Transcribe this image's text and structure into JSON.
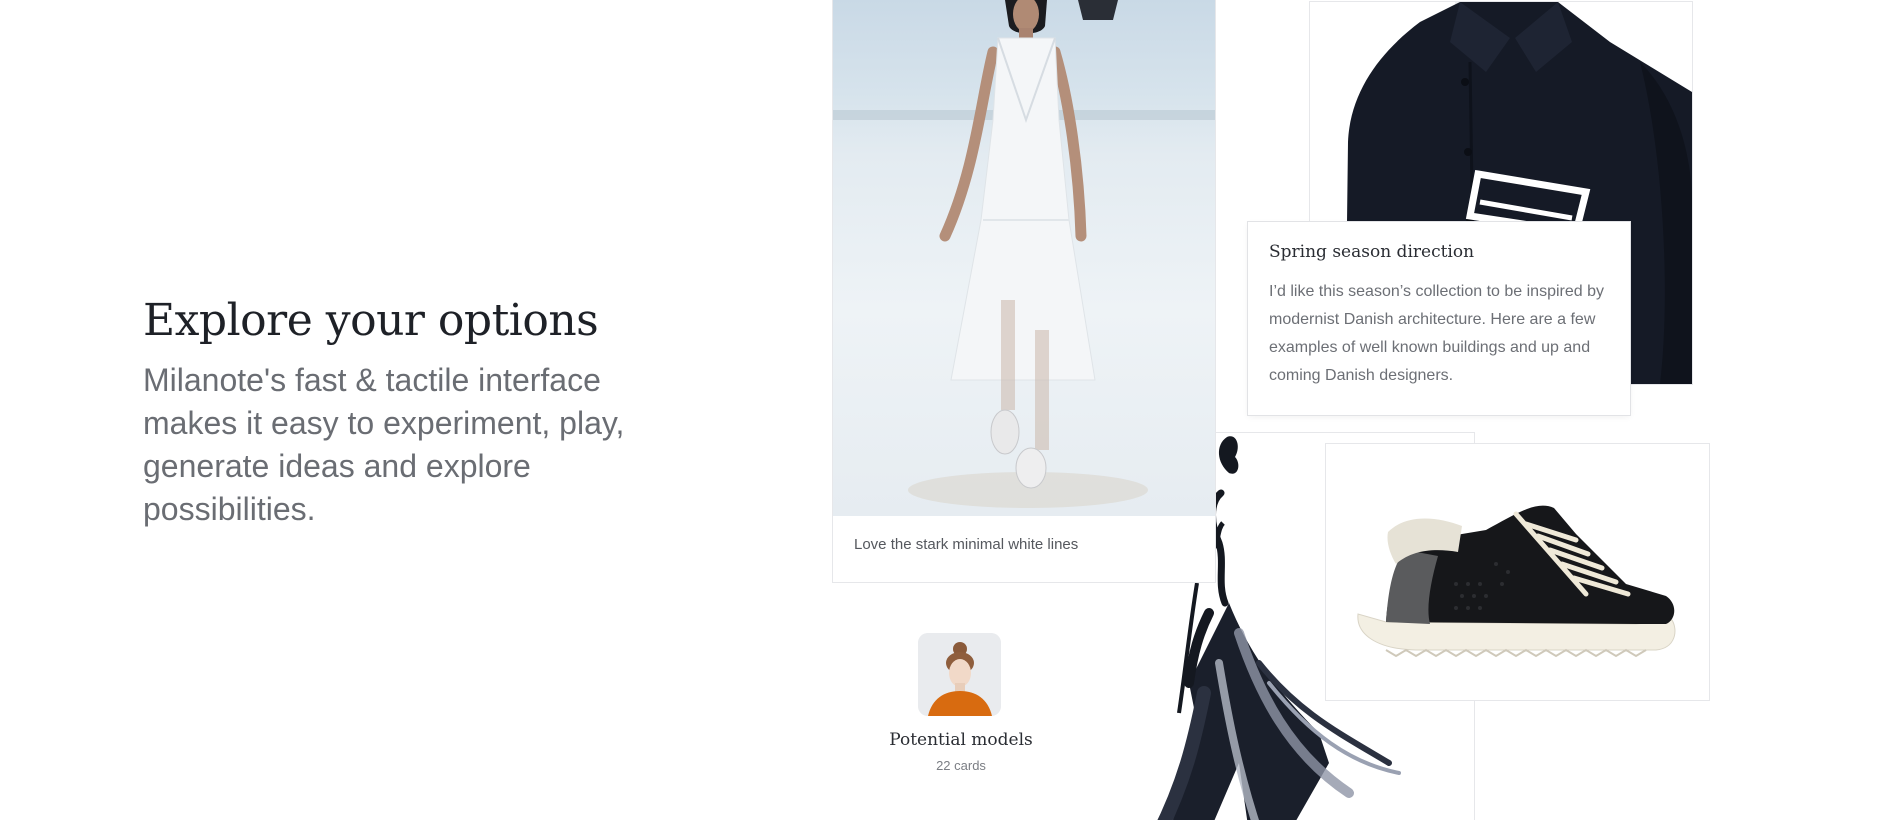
{
  "hero": {
    "title": "Explore your options",
    "description": "Milanote's fast & tactile interface makes it easy to experiment, play, generate ideas and explore possibilities."
  },
  "board": {
    "runway_card": {
      "image": "runway-model-white-dress",
      "caption": "Love the stark minimal white lines"
    },
    "shirt_card": {
      "image": "navy-shirt-with-white-pocket"
    },
    "note_card": {
      "title": "Spring season direction",
      "body": "I’d like this season’s collection to be inspired by modernist Danish architecture. Here are a few examples of well known buildings and up and coming Danish designers."
    },
    "sketch_card": {
      "image": "ink-fashion-sketch"
    },
    "shoe_card": {
      "image": "black-and-cream-sneaker"
    },
    "board_link": {
      "thumbnail": "child-model-portrait",
      "title": "Potential models",
      "count_label": "22 cards"
    }
  },
  "colors": {
    "heading": "#1e2127",
    "body_text": "#6a6d73",
    "card_border": "#e6e7ea",
    "shirt": "#151a26",
    "ink": "#141820"
  }
}
